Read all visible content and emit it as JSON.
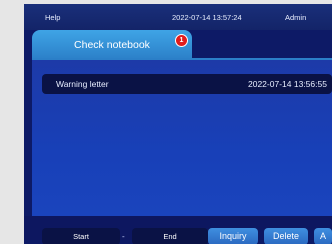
{
  "topbar": {
    "help": "Help",
    "datetime": "2022-07-14 13:57:24",
    "user": "Admin"
  },
  "tab": {
    "label": "Check notebook",
    "badge_count": "1"
  },
  "list": [
    {
      "title": "Warning letter",
      "time": "2022-07-14 13:56:55"
    }
  ],
  "filters": {
    "start_label": "Start",
    "separator": "-",
    "end_label": "End"
  },
  "actions": {
    "inquiry": "Inquiry",
    "delete": "Delete",
    "truncated": "A"
  }
}
